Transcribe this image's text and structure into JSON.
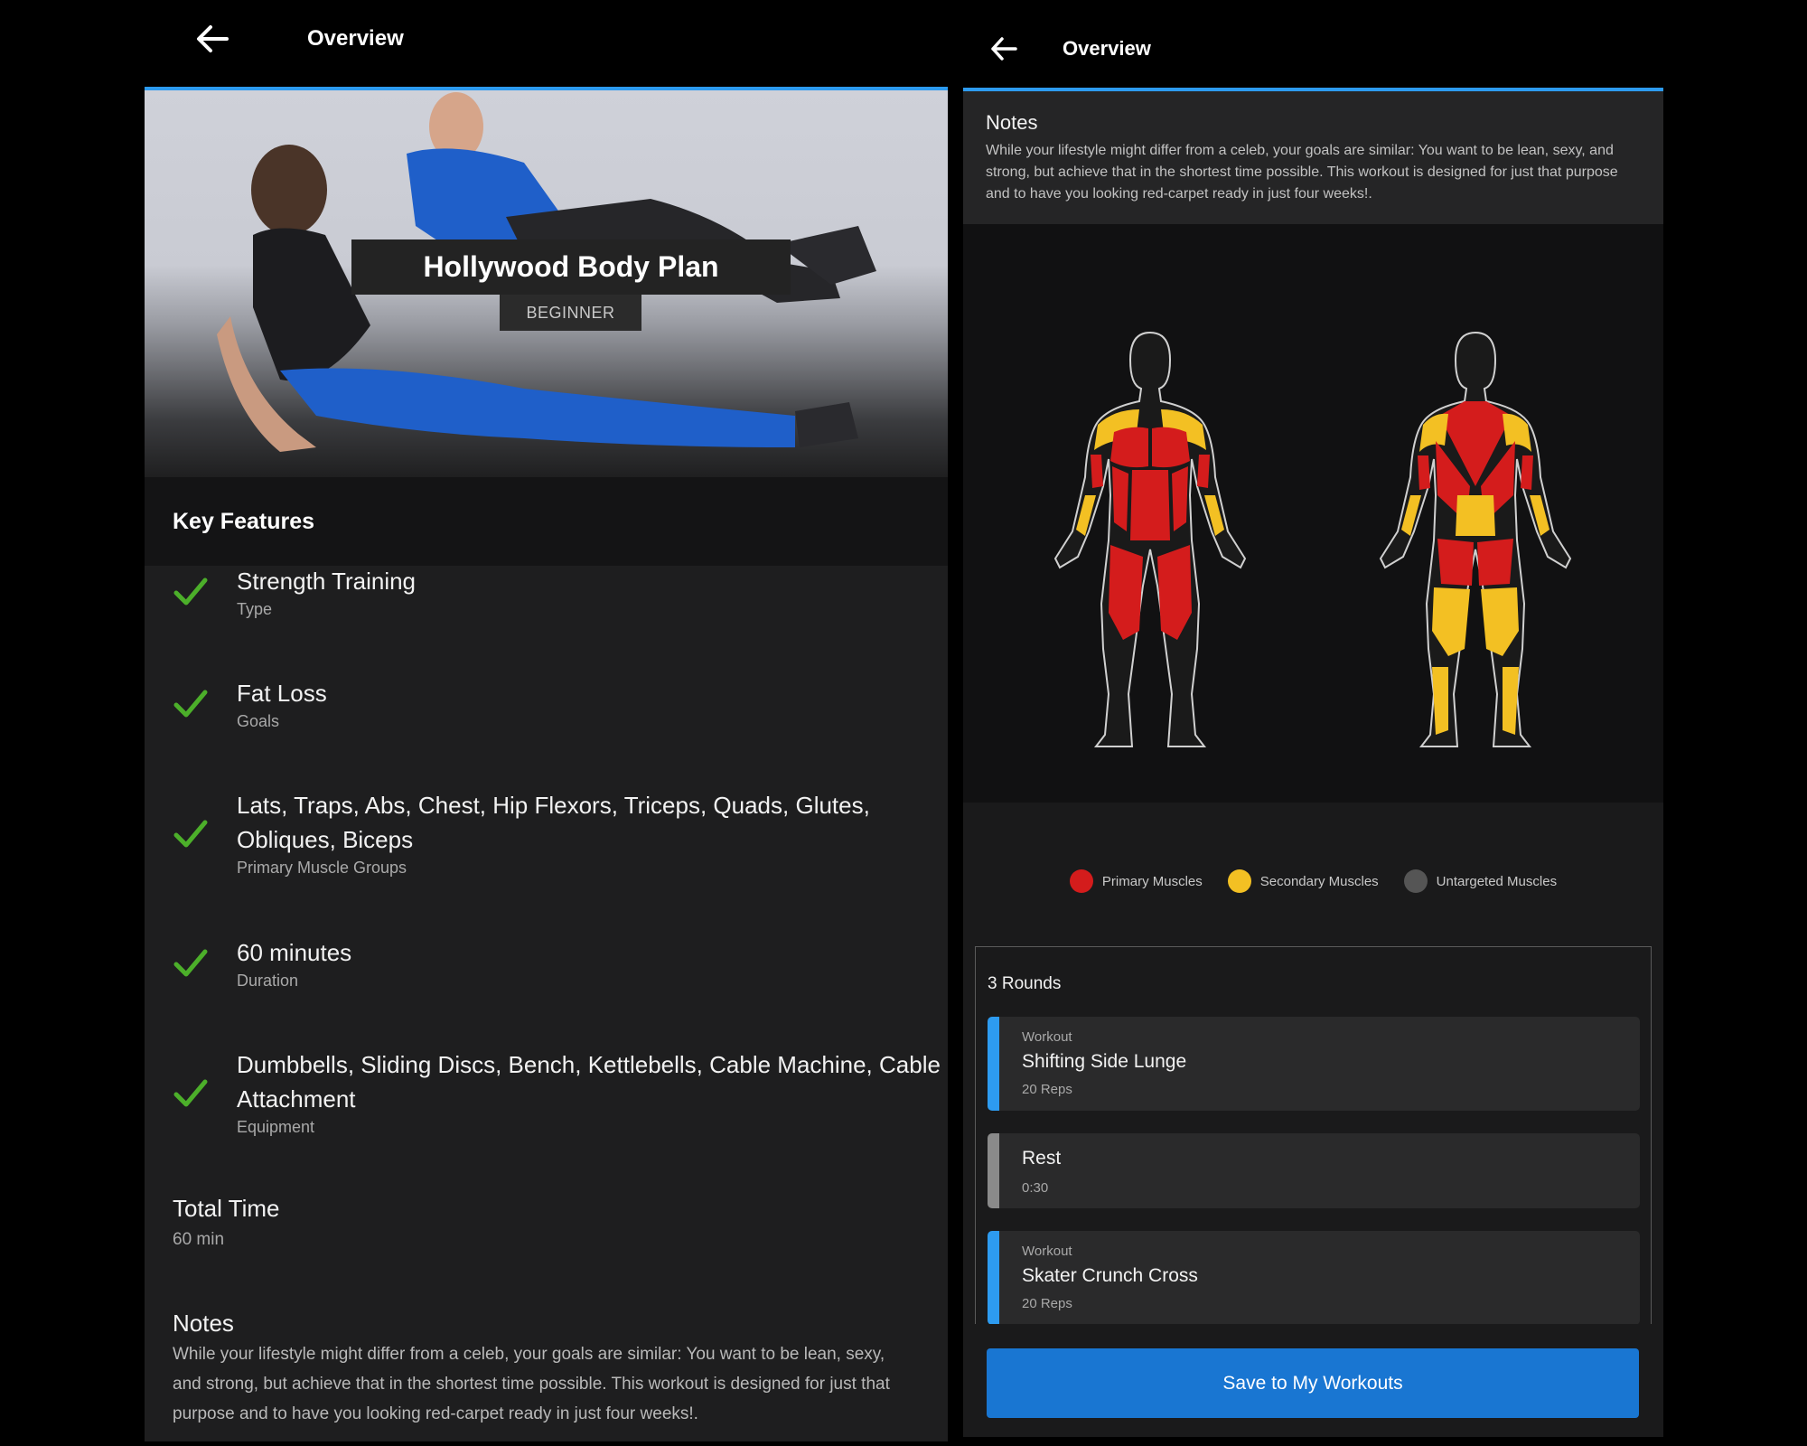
{
  "left": {
    "header": {
      "title": "Overview"
    },
    "hero": {
      "plan_name": "Hollywood Body Plan",
      "level": "BEGINNER"
    },
    "key_features": {
      "heading": "Key Features",
      "items": [
        {
          "value": "Strength Training",
          "label": "Type"
        },
        {
          "value": "Fat Loss",
          "label": "Goals"
        },
        {
          "value": "Lats, Traps, Abs, Chest, Hip Flexors, Triceps, Quads, Glutes, Obliques, Biceps",
          "label": "Primary Muscle Groups"
        },
        {
          "value": "60 minutes",
          "label": "Duration"
        },
        {
          "value": "Dumbbells, Sliding Discs, Bench, Kettlebells, Cable Machine, Cable Attachment",
          "label": "Equipment"
        }
      ]
    },
    "total_time": {
      "heading": "Total Time",
      "value": "60 min"
    },
    "notes": {
      "heading": "Notes",
      "line1": "While your lifestyle might differ from a celeb, your goals are similar: You want to be lean, sexy,",
      "line2": "and strong, but achieve that in the shortest time possible. This workout is designed for just that",
      "line3": "purpose and to have you looking red-carpet ready in just four weeks!."
    }
  },
  "right": {
    "header": {
      "title": "Overview"
    },
    "notes": {
      "heading": "Notes",
      "text": "While your lifestyle might differ from a celeb, your goals are similar: You want to be lean, sexy, and strong, but achieve that in the shortest time possible. This workout is designed for just that purpose and to have you looking red-carpet ready in just four weeks!."
    },
    "legend": [
      {
        "label": "Primary Muscles",
        "color": "#d41c1c"
      },
      {
        "label": "Secondary Muscles",
        "color": "#f3c023"
      },
      {
        "label": "Untargeted Muscles",
        "color": "#555555"
      }
    ],
    "rounds": {
      "title": "3 Rounds",
      "steps": [
        {
          "kind": "Workout",
          "name": "Shifting Side Lunge",
          "meta": "20 Reps",
          "accent": "#2d9bf0"
        },
        {
          "kind": "",
          "name": "Rest",
          "meta": "0:30",
          "accent": "#8a8a8a"
        },
        {
          "kind": "Workout",
          "name": "Skater Crunch Cross",
          "meta": "20 Reps",
          "accent": "#2d9bf0"
        }
      ]
    },
    "save_button": "Save to My Workouts"
  },
  "colors": {
    "accent_blue": "#2d9bf0",
    "check_green": "#4caf2a",
    "button_blue": "#1976d2"
  }
}
